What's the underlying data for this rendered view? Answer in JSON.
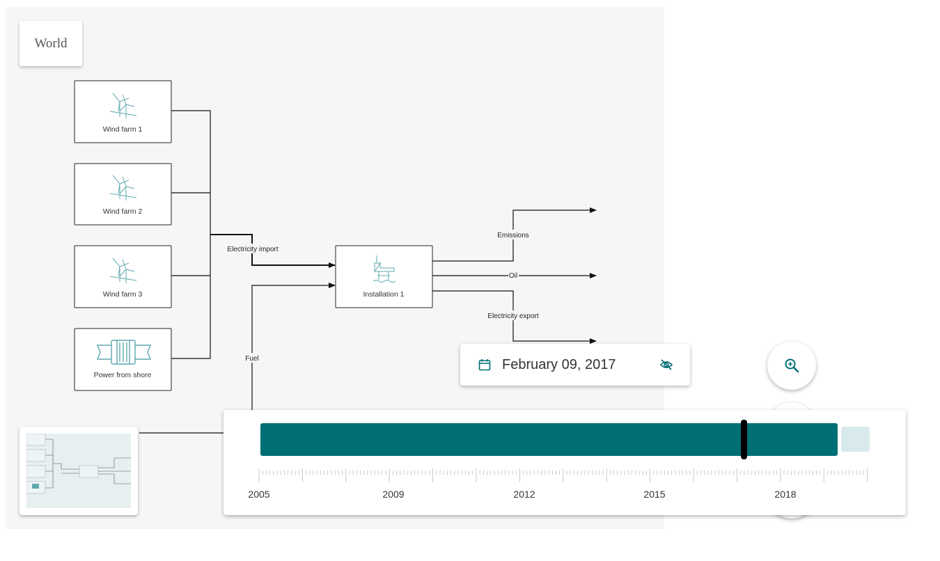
{
  "world_button": "World",
  "nodes": {
    "wind_farm_1": "Wind farm 1",
    "wind_farm_2": "Wind farm 2",
    "wind_farm_3": "Wind farm 3",
    "power_from_shore": "Power from shore",
    "installation_1": "Installation 1"
  },
  "edges": {
    "electricity_import": "Electricity import",
    "fuel": "Fuel",
    "emissions": "Emissions",
    "oil": "Oil",
    "electricity_export": "Electricity export"
  },
  "date_card": {
    "date": "February 09, 2017",
    "icons": [
      "calendar-icon",
      "eye-off-icon"
    ]
  },
  "zoom_icon": "zoom-in-icon",
  "timeline": {
    "years": [
      "2005",
      "2009",
      "2012",
      "2015",
      "2018"
    ],
    "selected_date": "2017-02-09",
    "colors": {
      "bar": "#006e75",
      "remaining": "#d9eaec",
      "handle": "#000000"
    }
  },
  "colors": {
    "accent": "#006e75",
    "icon": "#5fa8ad"
  }
}
